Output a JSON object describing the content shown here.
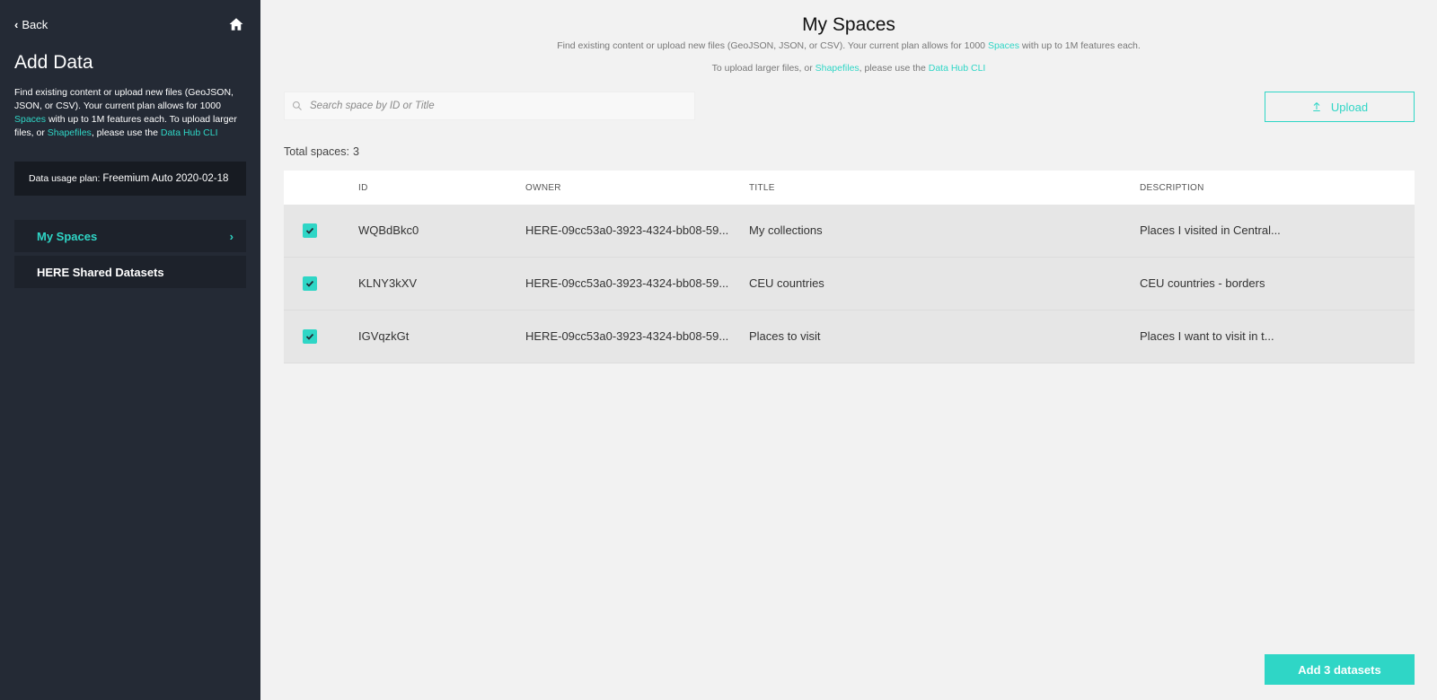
{
  "sidebar": {
    "back_label": "Back",
    "title": "Add Data",
    "desc_part1": "Find existing content or upload new files (GeoJSON, JSON, or CSV). Your current plan allows for 1000 ",
    "desc_link_spaces": "Spaces",
    "desc_part2": " with up to 1M features each. To upload larger files, or ",
    "desc_link_shapefiles": "Shapefiles",
    "desc_part3": ", please use the ",
    "desc_link_cli": "Data Hub CLI",
    "plan_label": "Data usage plan:",
    "plan_value": "Freemium Auto 2020-02-18",
    "nav": [
      {
        "label": "My Spaces",
        "active": true
      },
      {
        "label": "HERE Shared Datasets",
        "active": false
      }
    ]
  },
  "main": {
    "title": "My Spaces",
    "sub1_part1": "Find existing content or upload new files (GeoJSON, JSON, or CSV). Your current plan allows for 1000 ",
    "sub1_link": "Spaces",
    "sub1_part2": " with up to 1M features each.",
    "sub2_part1": "To upload larger files, or ",
    "sub2_link_shapefiles": "Shapefiles",
    "sub2_part2": ", please use the ",
    "sub2_link_cli": "Data Hub CLI",
    "search_placeholder": "Search space by ID or Title",
    "upload_label": "Upload",
    "total_label": "Total spaces:",
    "total_value": "3",
    "columns": [
      "ID",
      "OWNER",
      "TITLE",
      "DESCRIPTION"
    ],
    "rows": [
      {
        "checked": true,
        "id": "WQBdBkc0",
        "owner": "HERE-09cc53a0-3923-4324-bb08-59...",
        "title": "My collections",
        "description": "Places I visited in Central..."
      },
      {
        "checked": true,
        "id": "KLNY3kXV",
        "owner": "HERE-09cc53a0-3923-4324-bb08-59...",
        "title": "CEU countries",
        "description": "CEU countries - borders"
      },
      {
        "checked": true,
        "id": "IGVqzkGt",
        "owner": "HERE-09cc53a0-3923-4324-bb08-59...",
        "title": "Places to visit",
        "description": "Places I want to visit in t..."
      }
    ],
    "add_button_label": "Add 3 datasets"
  },
  "colors": {
    "accent": "#2fd6c6",
    "sidebar_bg": "#242a35",
    "main_bg": "#f2f2f2"
  },
  "icons": {
    "home": "home-icon",
    "search": "search-icon",
    "upload": "upload-icon",
    "check": "check-icon",
    "back": "chevron-left-icon",
    "nav_arrow": "chevron-right-icon"
  }
}
